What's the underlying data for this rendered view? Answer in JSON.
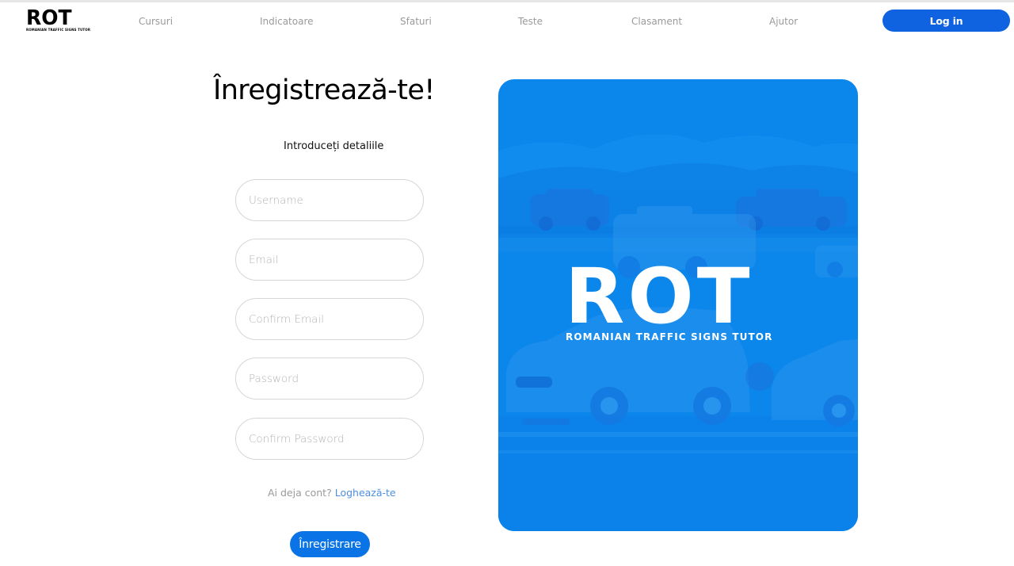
{
  "brand": {
    "logo_text": "ROT",
    "logo_tagline": "ROMANIAN TRAFFIC SIGNS TUTOR"
  },
  "nav": {
    "items": [
      {
        "label": "Cursuri"
      },
      {
        "label": "Indicatoare"
      },
      {
        "label": "Sfaturi"
      },
      {
        "label": "Teste"
      },
      {
        "label": "Clasament"
      },
      {
        "label": "Ajutor"
      }
    ],
    "login_label": "Log in"
  },
  "form": {
    "title": "Înregistrează-te!",
    "subtitle": "Introduceți detaliile",
    "fields": {
      "username": {
        "placeholder": "Username",
        "value": ""
      },
      "email": {
        "placeholder": "Email",
        "value": ""
      },
      "confirm_email": {
        "placeholder": "Confirm Email",
        "value": ""
      },
      "password": {
        "placeholder": "Password",
        "value": ""
      },
      "confirm_password": {
        "placeholder": "Confirm Password",
        "value": ""
      }
    },
    "account_prompt": "Ai deja cont?",
    "login_link": "Loghează-te",
    "submit_label": "Înregistrare"
  },
  "hero": {
    "logo_text": "ROT",
    "tagline": "ROMANIAN TRAFFIC SIGNS TUTOR"
  },
  "colors": {
    "primary": "#0f62e0",
    "hero_background": "#0b86ea",
    "link": "#4d8fe0",
    "nav_text": "#9a9a9a"
  }
}
